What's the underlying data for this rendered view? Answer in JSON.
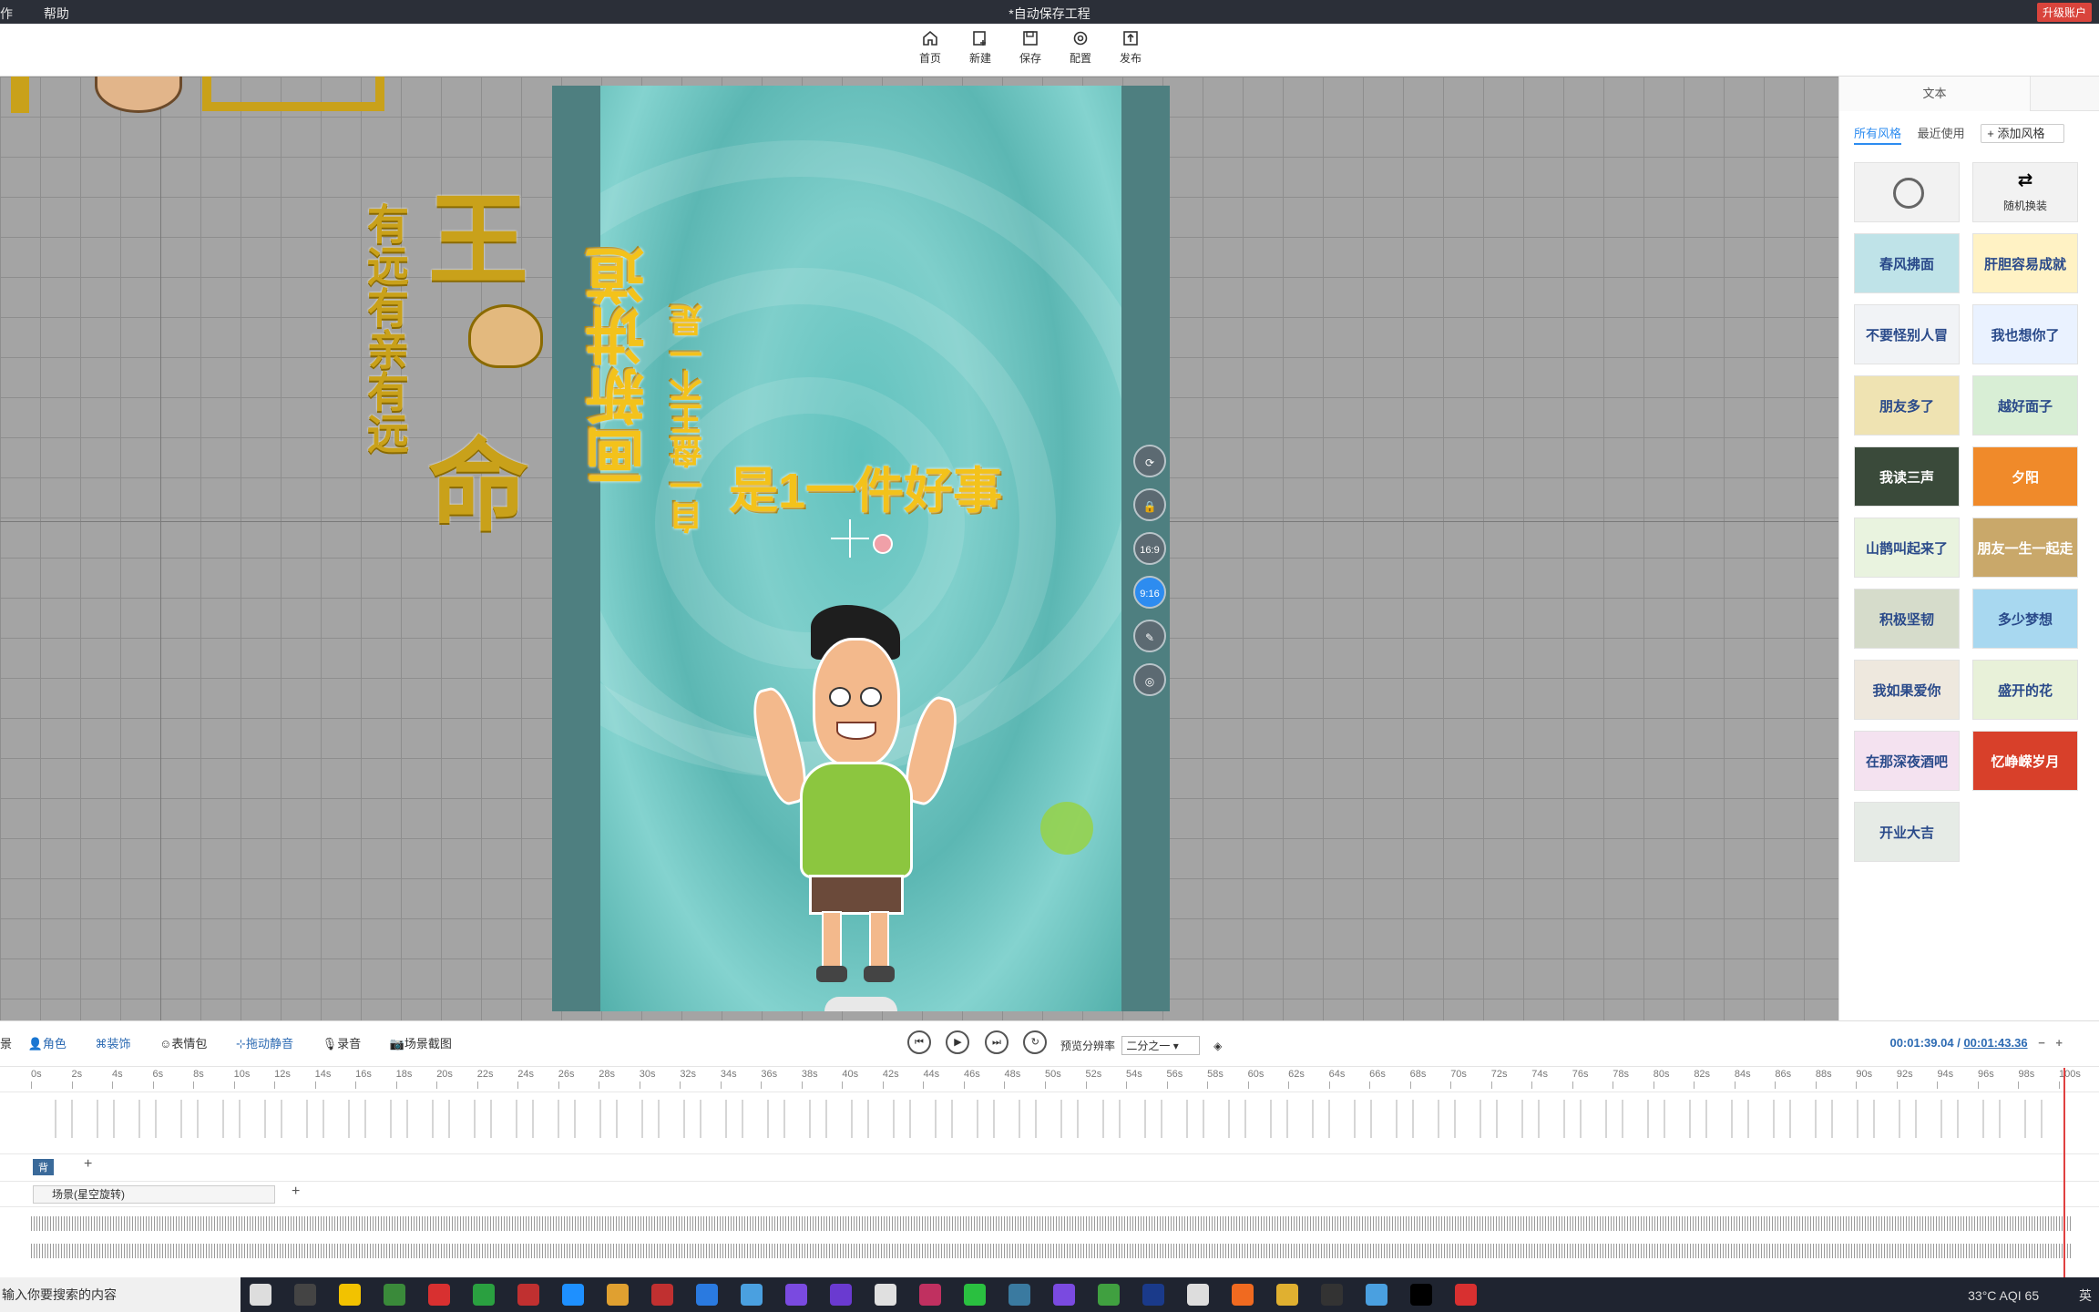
{
  "titlebar": {
    "menu": [
      "作",
      "帮助"
    ],
    "title": "*自动保存工程",
    "upgrade": "升级账户"
  },
  "toolbar": {
    "items": [
      {
        "label": "首页",
        "icon": "home-icon"
      },
      {
        "label": "新建",
        "icon": "new-icon"
      },
      {
        "label": "保存",
        "icon": "save-icon"
      },
      {
        "label": "配置",
        "icon": "settings-icon"
      },
      {
        "label": "发布",
        "icon": "publish-icon"
      }
    ]
  },
  "canvas": {
    "offstage_text": [
      "有远有亲有远",
      "命",
      "王"
    ],
    "stage_text": {
      "vertical_title": "画新讲道",
      "vertical_sub": "自一盘王不一是",
      "headline": "是1一件好事"
    },
    "side_buttons": [
      "⟳",
      "🔒",
      "16:9",
      "9:16",
      "✎",
      "◎"
    ]
  },
  "right_panel": {
    "tab": "文本",
    "subtabs": {
      "all": "所有风格",
      "recent": "最近使用",
      "add": "添加风格"
    },
    "styles": [
      {
        "label": "",
        "kind": "none"
      },
      {
        "label": "随机换装",
        "kind": "random"
      },
      {
        "label": "",
        "color": "#bfe3e8",
        "text": "春风拂面"
      },
      {
        "label": "",
        "color": "#fff2c4",
        "text": "肝胆容易成就"
      },
      {
        "label": "",
        "color": "#f1f3f6",
        "text": "不要怪别人冒"
      },
      {
        "label": "",
        "color": "#eaf2ff",
        "text": "我也想你了"
      },
      {
        "label": "",
        "color": "#efe3b2",
        "text": "朋友多了"
      },
      {
        "label": "",
        "color": "#d8eed5",
        "text": "越好面子"
      },
      {
        "label": "",
        "color": "#3a4a3a",
        "text": "我读三声"
      },
      {
        "label": "",
        "color": "#f08a2a",
        "text": "夕阳"
      },
      {
        "label": "",
        "color": "#e9f3df",
        "text": "山鹊叫起来了"
      },
      {
        "label": "",
        "color": "#c9a86a",
        "text": "朋友一生一起走"
      },
      {
        "label": "",
        "color": "#d6dccb",
        "text": "积极坚韧"
      },
      {
        "label": "",
        "color": "#a8d8f0",
        "text": "多少梦想"
      },
      {
        "label": "",
        "color": "#eee8de",
        "text": "我如果爱你"
      },
      {
        "label": "",
        "color": "#e8f1d9",
        "text": "盛开的花"
      },
      {
        "label": "",
        "color": "#f4e2f0",
        "text": "在那深夜酒吧"
      },
      {
        "label": "",
        "color": "#d8402a",
        "text": "忆峥嵘岁月"
      },
      {
        "label": "",
        "color": "#e6ebe6",
        "text": "开业大吉"
      }
    ]
  },
  "timeline": {
    "tools": [
      "景",
      "角色",
      "装饰",
      "表情包",
      "拖动静音",
      "录音",
      "场景截图"
    ],
    "resolution_label": "预览分辨率",
    "resolution_value": "二分之一",
    "current_time": "00:01:39.04",
    "total_time": "00:01:43.36",
    "ruler": [
      "0s",
      "2s",
      "4s",
      "6s",
      "8s",
      "10s",
      "12s",
      "14s",
      "16s",
      "18s",
      "20s",
      "22s",
      "24s",
      "26s",
      "28s",
      "30s",
      "32s",
      "34s",
      "36s",
      "38s",
      "40s",
      "42s",
      "44s",
      "46s",
      "48s",
      "50s",
      "52s",
      "54s",
      "56s",
      "58s",
      "60s",
      "62s",
      "64s",
      "66s",
      "68s",
      "70s",
      "72s",
      "74s",
      "76s",
      "78s",
      "80s",
      "82s",
      "84s",
      "86s",
      "88s",
      "90s",
      "92s",
      "94s",
      "96s",
      "98s",
      "100s"
    ],
    "scene_track": "场景(星空旋转)",
    "layer_tag": "背"
  },
  "taskbar": {
    "search_placeholder": "输入你要搜索的内容",
    "weather": "33°C AQI 65",
    "ime": "英"
  }
}
